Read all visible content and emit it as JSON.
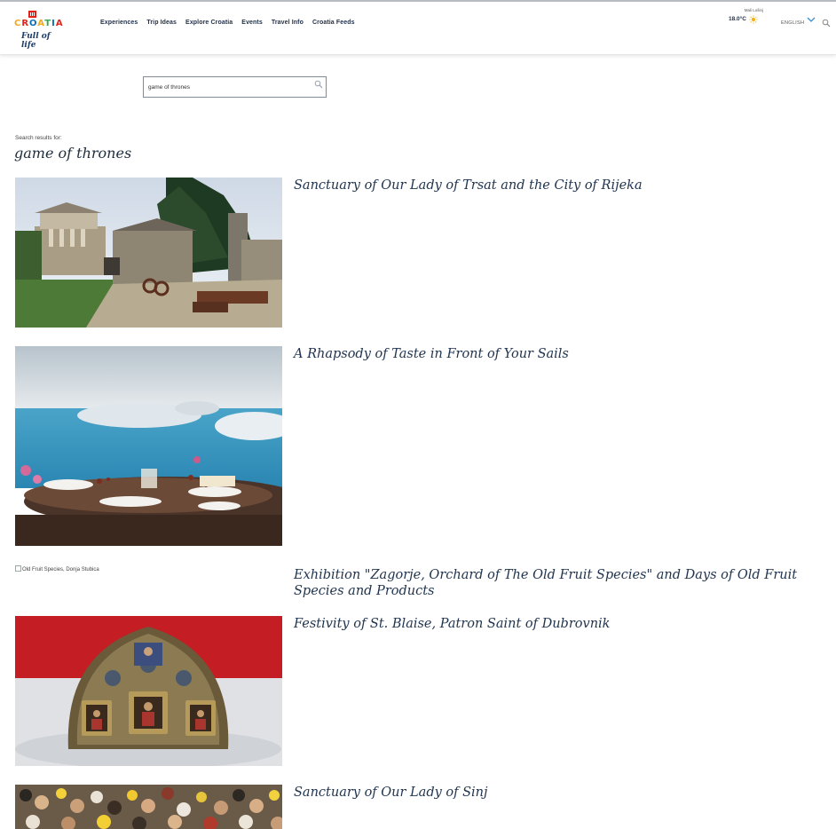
{
  "header": {
    "logo": {
      "word": [
        "C",
        "R",
        "O",
        "A",
        "T",
        "I",
        "A"
      ],
      "tagline": "Full of life"
    },
    "nav": [
      "Experiences",
      "Trip Ideas",
      "Explore Croatia",
      "Events",
      "Travel Info",
      "Croatia Feeds"
    ],
    "weather": {
      "city": "Mali Lošinj",
      "temp": "18.0°C",
      "icon": "sun-icon"
    },
    "language": "ENGLISH"
  },
  "search": {
    "value": "game of thrones",
    "icon": "search-icon"
  },
  "results_label": "Search results for:",
  "query": "game of thrones",
  "results": [
    {
      "title": "Sanctuary of Our Lady of Trsat and the City of Rijeka"
    },
    {
      "title": "A Rhapsody of Taste in Front of Your Sails"
    },
    {
      "title": "Exhibition \"Zagorje, Orchard of The Old Fruit Species\" and Days of Old Fruit Species and Products",
      "image_alt": "Old Fruit Species, Donja Stubica"
    },
    {
      "title": "Festivity of St. Blaise, Patron Saint of Dubrovnik"
    },
    {
      "title": "Sanctuary of Our Lady of Sinj"
    }
  ],
  "colors": {
    "accent": "#0a6fb5",
    "title_text": "#213550",
    "sun": "#f3b21c"
  }
}
